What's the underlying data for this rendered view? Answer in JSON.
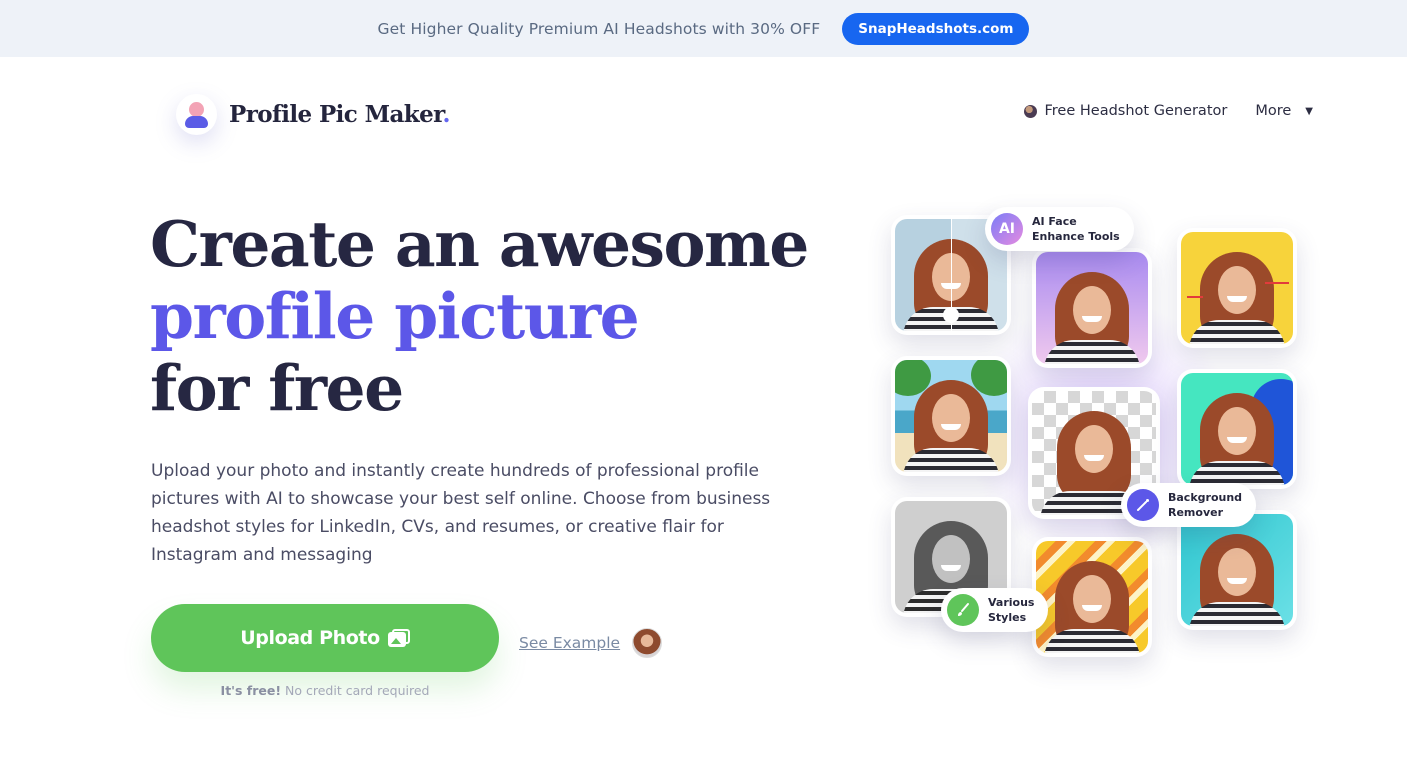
{
  "promo": {
    "text": "Get Higher Quality Premium AI Headshots with 30% OFF",
    "button": "SnapHeadshots.com"
  },
  "header": {
    "logo_text": "Profile Pic Maker",
    "logo_dot": ".",
    "nav": {
      "headshot": "Free Headshot Generator",
      "more": "More",
      "more_caret": "▼"
    }
  },
  "hero": {
    "title_line1": "Create an awesome",
    "title_line2": "profile picture",
    "title_line3": "for free",
    "description": "Upload your photo and instantly create hundreds of professional profile pictures with AI to showcase your best self online. Choose from business headshot styles for LinkedIn, CVs, and resumes, or creative flair for Instagram and messaging",
    "upload_label": "Upload Photo",
    "see_example": "See Example",
    "fine_bold": "It's free!",
    "fine_text": " No credit card required"
  },
  "collage": {
    "badges": {
      "ai_face_icon": "AI",
      "ai_face_line1": "AI Face",
      "ai_face_line2": "Enhance Tools",
      "bg_remover_line1": "Background",
      "bg_remover_line2": "Remover",
      "styles_line1": "Various",
      "styles_line2": "Styles"
    }
  },
  "colors": {
    "accent": "#5c57e8",
    "primary_button": "#5fc55a",
    "promo_button": "#1766f0"
  },
  "icons": [
    "person-logo-icon",
    "avatar-emoji-icon",
    "image-icon",
    "ai-icon",
    "magic-wand-icon",
    "brush-icon"
  ]
}
